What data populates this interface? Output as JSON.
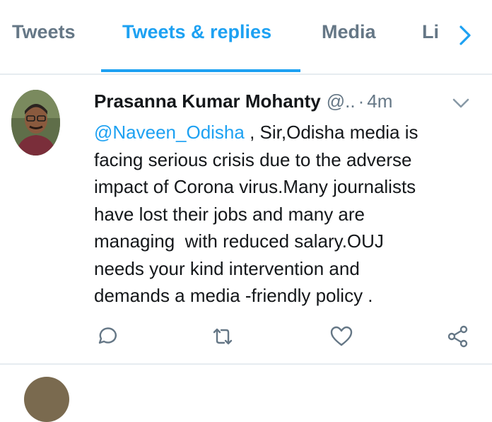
{
  "tabs": {
    "items": [
      {
        "label": "Tweets"
      },
      {
        "label": "Tweets & replies"
      },
      {
        "label": "Media"
      },
      {
        "label": "Li"
      }
    ],
    "active_index": 1
  },
  "tweet": {
    "author_name": "Prasanna Kumar Mohanty",
    "handle": "@..",
    "separator": "·",
    "time": "4m",
    "mention": "@Naveen_Odisha",
    "lines": [
      " , Sir,Odisha media is",
      "facing serious crisis due to the adverse",
      "impact of Corona virus.Many journalists",
      "have lost their jobs and many are",
      "managing  with reduced salary.OUJ",
      "needs your kind intervention and",
      "demands a media -friendly policy ."
    ]
  },
  "actions": [
    "reply-icon",
    "retweet-icon",
    "like-icon",
    "share-icon"
  ],
  "colors": {
    "accent": "#1da1f2",
    "secondary_text": "#657786",
    "text": "#14171a",
    "divider": "#e6ecf0"
  }
}
